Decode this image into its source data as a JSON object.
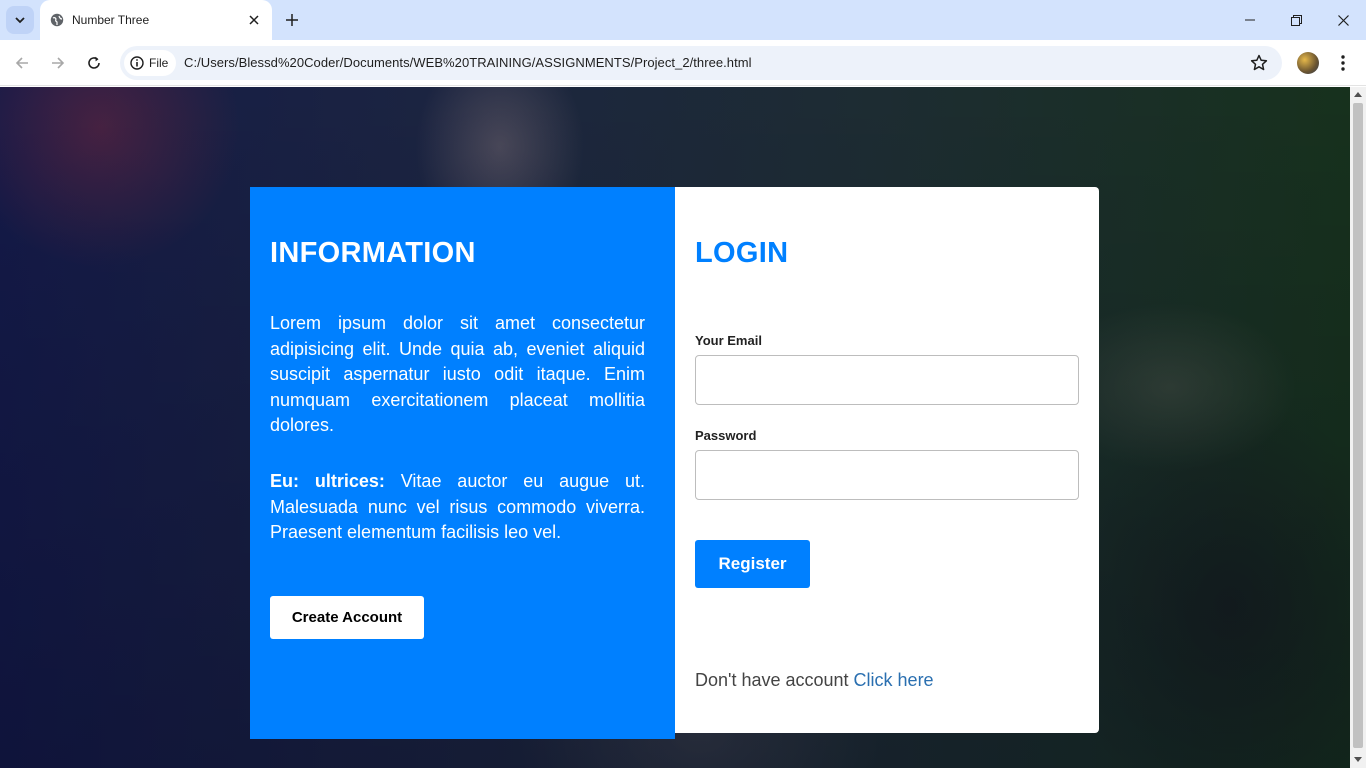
{
  "browser": {
    "tab_title": "Number Three",
    "chip_label": "File",
    "url": "C:/Users/Blessd%20Coder/Documents/WEB%20TRAINING/ASSIGNMENTS/Project_2/three.html"
  },
  "info": {
    "heading": "INFORMATION",
    "paragraph1": "Lorem ipsum dolor sit amet consectetur adipisicing elit. Unde quia ab, eveniet aliquid suscipit aspernatur iusto odit itaque. Enim numquam exercitationem placeat mollitia dolores.",
    "paragraph2_bold": "Eu: ultrices:",
    "paragraph2_rest": " Vitae auctor eu augue ut. Malesuada nunc vel risus commodo viverra. Praesent elementum facilisis leo vel.",
    "create_button": "Create Account"
  },
  "login": {
    "heading": "LOGIN",
    "email_label": "Your Email",
    "email_value": "",
    "password_label": "Password",
    "password_value": "",
    "register_button": "Register",
    "signup_prompt": "Don't have account ",
    "signup_link": "Click here"
  },
  "colors": {
    "accent": "#0080ff",
    "link": "#2a6fb0"
  }
}
